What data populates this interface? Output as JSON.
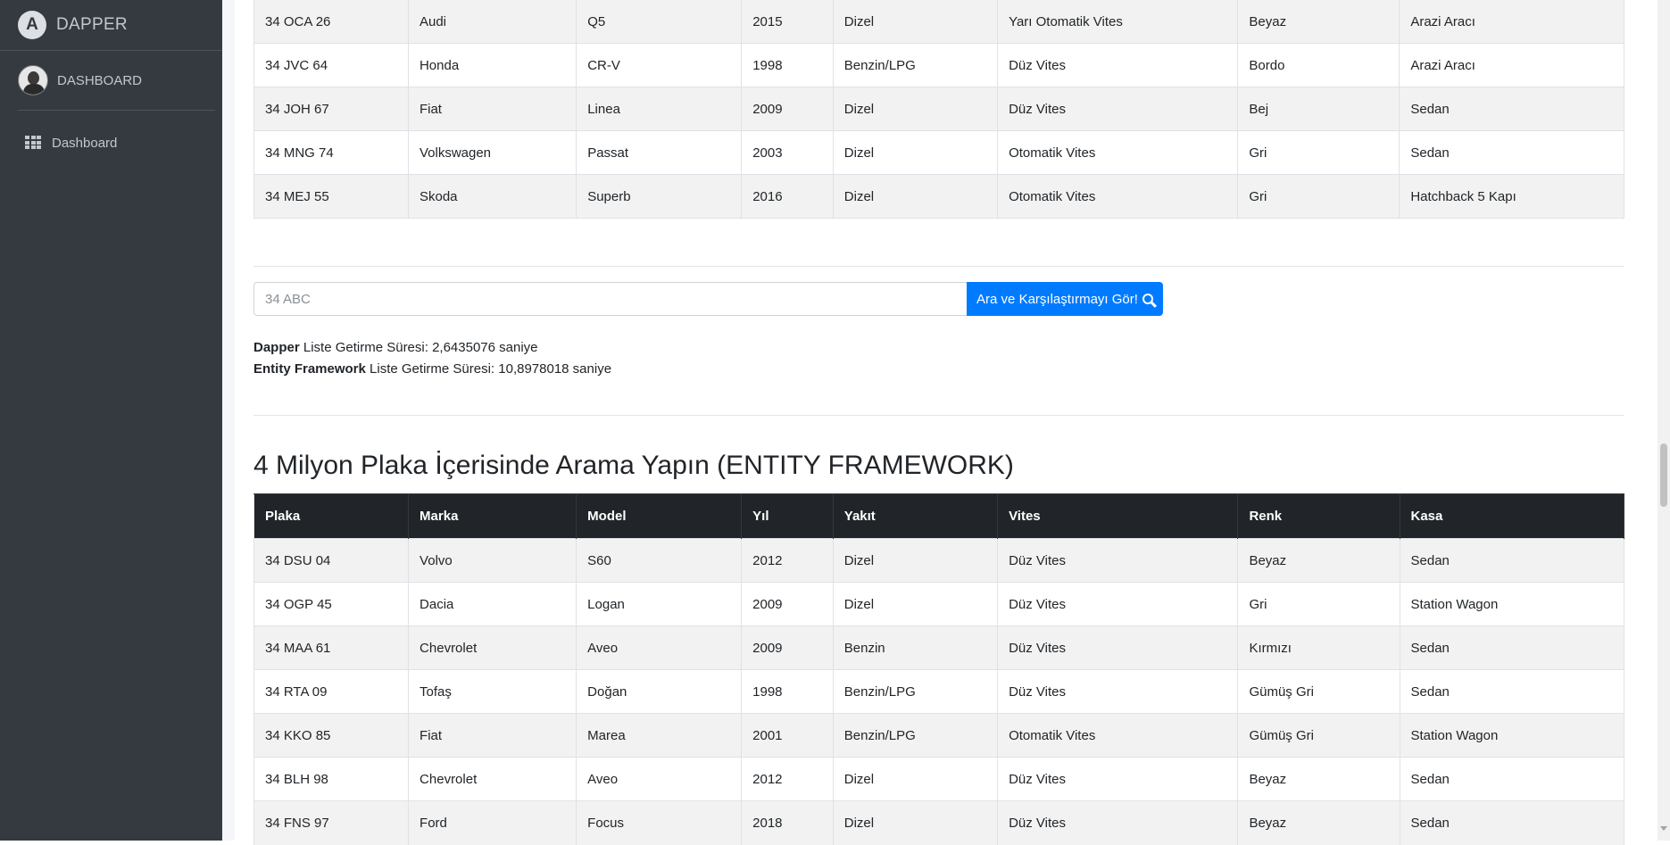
{
  "sidebar": {
    "brand": "DAPPER",
    "user_name": "DASHBOARD",
    "nav_items": [
      {
        "label": "Dashboard",
        "icon": "th-grid-icon"
      }
    ]
  },
  "top_table": {
    "rows": [
      [
        "34 OCA 26",
        "Audi",
        "Q5",
        "2015",
        "Dizel",
        "Yarı Otomatik Vites",
        "Beyaz",
        "Arazi Aracı"
      ],
      [
        "34 JVC 64",
        "Honda",
        "CR-V",
        "1998",
        "Benzin/LPG",
        "Düz Vites",
        "Bordo",
        "Arazi Aracı"
      ],
      [
        "34 JOH 67",
        "Fiat",
        "Linea",
        "2009",
        "Dizel",
        "Düz Vites",
        "Bej",
        "Sedan"
      ],
      [
        "34 MNG 74",
        "Volkswagen",
        "Passat",
        "2003",
        "Dizel",
        "Otomatik Vites",
        "Gri",
        "Sedan"
      ],
      [
        "34 MEJ 55",
        "Skoda",
        "Superb",
        "2016",
        "Dizel",
        "Otomatik Vites",
        "Gri",
        "Hatchback 5 Kapı"
      ]
    ]
  },
  "search": {
    "placeholder": "34 ABC",
    "button_label": "Ara ve Karşılaştırmayı Gör!"
  },
  "timings": {
    "dapper_label": "Dapper",
    "dapper_text": " Liste Getirme Süresi: 2,6435076 saniye",
    "ef_label": "Entity Framework",
    "ef_text": " Liste Getirme Süresi: 10,8978018 saniye"
  },
  "section_title": "4 Milyon Plaka İçerisinde Arama Yapın (ENTITY FRAMEWORK)",
  "ef_table": {
    "headers": [
      "Plaka",
      "Marka",
      "Model",
      "Yıl",
      "Yakıt",
      "Vites",
      "Renk",
      "Kasa"
    ],
    "rows": [
      [
        "34 DSU 04",
        "Volvo",
        "S60",
        "2012",
        "Dizel",
        "Düz Vites",
        "Beyaz",
        "Sedan"
      ],
      [
        "34 OGP 45",
        "Dacia",
        "Logan",
        "2009",
        "Dizel",
        "Düz Vites",
        "Gri",
        "Station Wagon"
      ],
      [
        "34 MAA 61",
        "Chevrolet",
        "Aveo",
        "2009",
        "Benzin",
        "Düz Vites",
        "Kırmızı",
        "Sedan"
      ],
      [
        "34 RTA 09",
        "Tofaş",
        "Doğan",
        "1998",
        "Benzin/LPG",
        "Düz Vites",
        "Gümüş Gri",
        "Sedan"
      ],
      [
        "34 KKO 85",
        "Fiat",
        "Marea",
        "2001",
        "Benzin/LPG",
        "Otomatik Vites",
        "Gümüş Gri",
        "Station Wagon"
      ],
      [
        "34 BLH 98",
        "Chevrolet",
        "Aveo",
        "2012",
        "Dizel",
        "Düz Vites",
        "Beyaz",
        "Sedan"
      ],
      [
        "34 FNS 97",
        "Ford",
        "Focus",
        "2018",
        "Dizel",
        "Düz Vites",
        "Beyaz",
        "Sedan"
      ]
    ]
  },
  "colors": {
    "sidebar_bg": "#343a40",
    "primary": "#007bff",
    "table_header_bg": "#212529",
    "stripe": "#f2f2f2"
  }
}
